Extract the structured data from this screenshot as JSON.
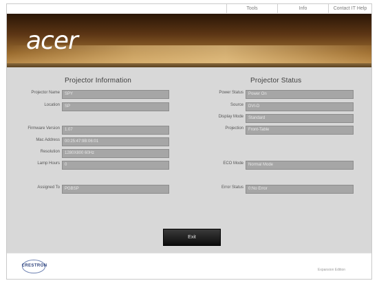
{
  "topnav": {
    "tools": "Tools",
    "info": "Info",
    "contact": "Contact IT Help"
  },
  "banner": {
    "logo": "acer"
  },
  "info": {
    "title": "Projector Information",
    "projector_name": {
      "label": "Projector Name",
      "value": "SPY"
    },
    "location": {
      "label": "Location",
      "value": "SP"
    },
    "firmware": {
      "label": "Firmware Version",
      "value": "1.07"
    },
    "mac": {
      "label": "Mac Address",
      "value": "00:25:47:9B:06:01"
    },
    "resolution": {
      "label": "Resolution",
      "value": "1280X800 60Hz"
    },
    "lamp_hours": {
      "label": "Lamp Hours",
      "value": "0"
    },
    "assigned_to": {
      "label": "Assigned To",
      "value": "PGBSP"
    }
  },
  "status": {
    "title": "Projector Status",
    "power": {
      "label": "Power Status",
      "value": "Power On"
    },
    "source": {
      "label": "Source",
      "value": "DVI-D"
    },
    "display_mode": {
      "label": "Display Mode",
      "value": "Standard"
    },
    "projection": {
      "label": "Projection",
      "value": "Front-Table"
    },
    "eco_mode": {
      "label": "ECO Mode",
      "value": "Normal Mode"
    },
    "error_status": {
      "label": "Error Status",
      "value": "0:No Error"
    }
  },
  "exit_label": "Exit",
  "footer": {
    "brand": "CRESTRON",
    "powered": "Expansion Edition"
  }
}
